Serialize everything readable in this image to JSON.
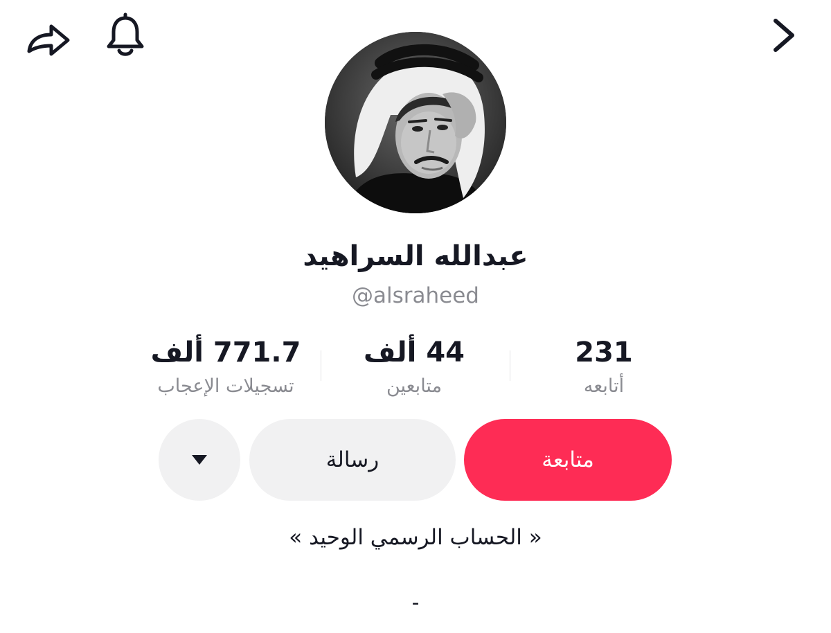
{
  "topbar": {
    "share_icon": "share-arrow-icon",
    "bell_icon": "bell-icon",
    "back_icon": "chevron-right-icon"
  },
  "profile": {
    "display_name": "عبدالله السراهيد",
    "username": "@alsraheed",
    "avatar_icon": "profile-photo"
  },
  "stats": {
    "following": {
      "value": "231",
      "label": "أتابعه"
    },
    "followers": {
      "value": "44 ألف",
      "label": "متابعين"
    },
    "likes": {
      "value": "771.7 ألف",
      "label": "تسجيلات الإعجاب"
    }
  },
  "actions": {
    "follow_label": "متابعة",
    "message_label": "رسالة",
    "more_icon": "triangle-down-icon"
  },
  "bio": {
    "line1": "« الحساب الرسمي الوحيد »",
    "line2": "-"
  },
  "colors": {
    "accent": "#fe2c55",
    "secondary_button": "#f1f1f2",
    "muted_text": "#8a8b91",
    "primary_text": "#161823"
  }
}
